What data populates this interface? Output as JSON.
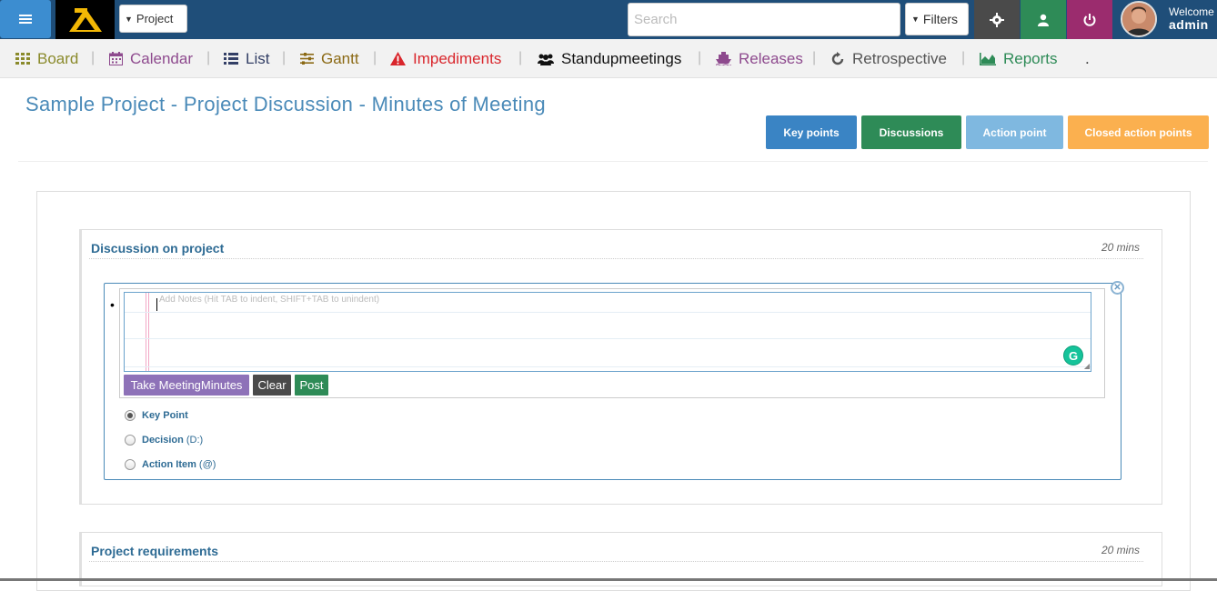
{
  "topbar": {
    "project_label": "Project",
    "search_placeholder": "Search",
    "filters_label": "Filters",
    "welcome_text": "Welcome",
    "username": "admin",
    "colors": {
      "bar": "#1f4e79",
      "menu": "#3c8dd0",
      "settings": "#4a4a4a",
      "user": "#2e8b57",
      "power": "#9b2c6e"
    }
  },
  "nav": {
    "items": [
      {
        "label": "Board",
        "icon": "grid-icon",
        "color": "#8a8a2b"
      },
      {
        "label": "Calendar",
        "icon": "calendar-icon",
        "color": "#8e4a8e"
      },
      {
        "label": "List",
        "icon": "list-icon",
        "color": "#333f66"
      },
      {
        "label": "Gantt",
        "icon": "gantt-icon",
        "color": "#8b6914"
      },
      {
        "label": "Impediments",
        "icon": "warning-icon",
        "color": "#d9262c"
      },
      {
        "label": "Standupmeetings",
        "icon": "users-icon",
        "color": "#111111"
      },
      {
        "label": "Releases",
        "icon": "ship-icon",
        "color": "#8e4a8e"
      },
      {
        "label": "Retrospective",
        "icon": "refresh-icon",
        "color": "#555555"
      },
      {
        "label": "Reports",
        "icon": "area-chart-icon",
        "color": "#2e8b57"
      }
    ],
    "more": "."
  },
  "header": {
    "title": "Sample Project - Project Discussion - Minutes of Meeting",
    "buttons": [
      {
        "label": "Key points",
        "color": "#3a84c4"
      },
      {
        "label": "Discussions",
        "color": "#2e8b57"
      },
      {
        "label": "Action point",
        "color": "#7fb8e0"
      },
      {
        "label": "Closed action points",
        "color": "#fbb04f"
      }
    ]
  },
  "topics": [
    {
      "title": "Discussion on project",
      "time": "20 mins"
    },
    {
      "title": "Project requirements",
      "time": "20 mins"
    }
  ],
  "editor": {
    "bullet": "•",
    "placeholder": "Add Notes (Hit TAB to indent, SHIFT+TAB to unindent)",
    "buttons": [
      {
        "label": "Take MeetingMinutes",
        "color": "#8e72b8"
      },
      {
        "label": "Clear",
        "color": "#4a4a4a"
      },
      {
        "label": "Post",
        "color": "#2e8b57"
      }
    ],
    "types": [
      {
        "label": "Key Point",
        "hint": "",
        "checked": true
      },
      {
        "label": "Decision",
        "hint": "(D:)",
        "checked": false
      },
      {
        "label": "Action Item",
        "hint": "(@)",
        "checked": false
      }
    ],
    "grammarly_letter": "G"
  }
}
